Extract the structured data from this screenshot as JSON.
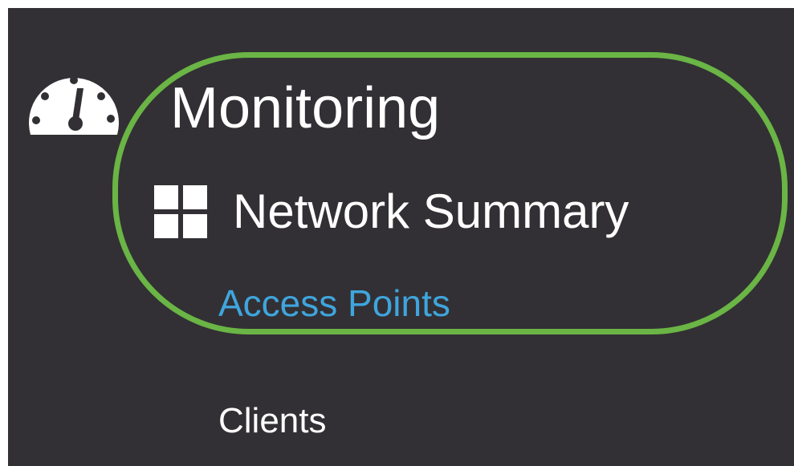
{
  "colors": {
    "sidebar_bg": "#323034",
    "text_primary": "#ffffff",
    "link_active": "#3fa5dd",
    "highlight_outline": "#6ab545"
  },
  "section": {
    "icon": "dashboard-gauge-icon",
    "title": "Monitoring"
  },
  "nav": {
    "summary": {
      "icon": "grid-icon",
      "label": "Network Summary"
    },
    "access_points": {
      "label": "Access Points"
    },
    "clients": {
      "label": "Clients"
    }
  }
}
